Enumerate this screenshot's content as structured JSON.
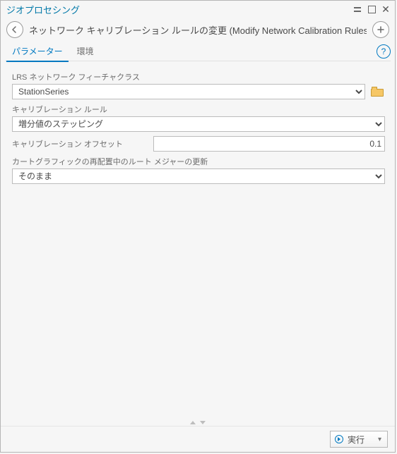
{
  "window": {
    "title": "ジオプロセシング"
  },
  "tool": {
    "title": "ネットワーク キャリブレーション ルールの変更 (Modify Network Calibration Rules)"
  },
  "tabs": {
    "parameters": "パラメーター",
    "environment": "環境"
  },
  "fields": {
    "lrs_label": "LRS ネットワーク フィーチャクラス",
    "lrs_value": "StationSeries",
    "calib_rule_label": "キャリブレーション ルール",
    "calib_rule_value": "増分値のステッピング",
    "calib_offset_label": "キャリブレーション オフセット",
    "calib_offset_value": "0.1",
    "carto_label": "カートグラフィックの再配置中のルート メジャーの更新",
    "carto_value": "そのまま"
  },
  "footer": {
    "run_label": "実行"
  }
}
